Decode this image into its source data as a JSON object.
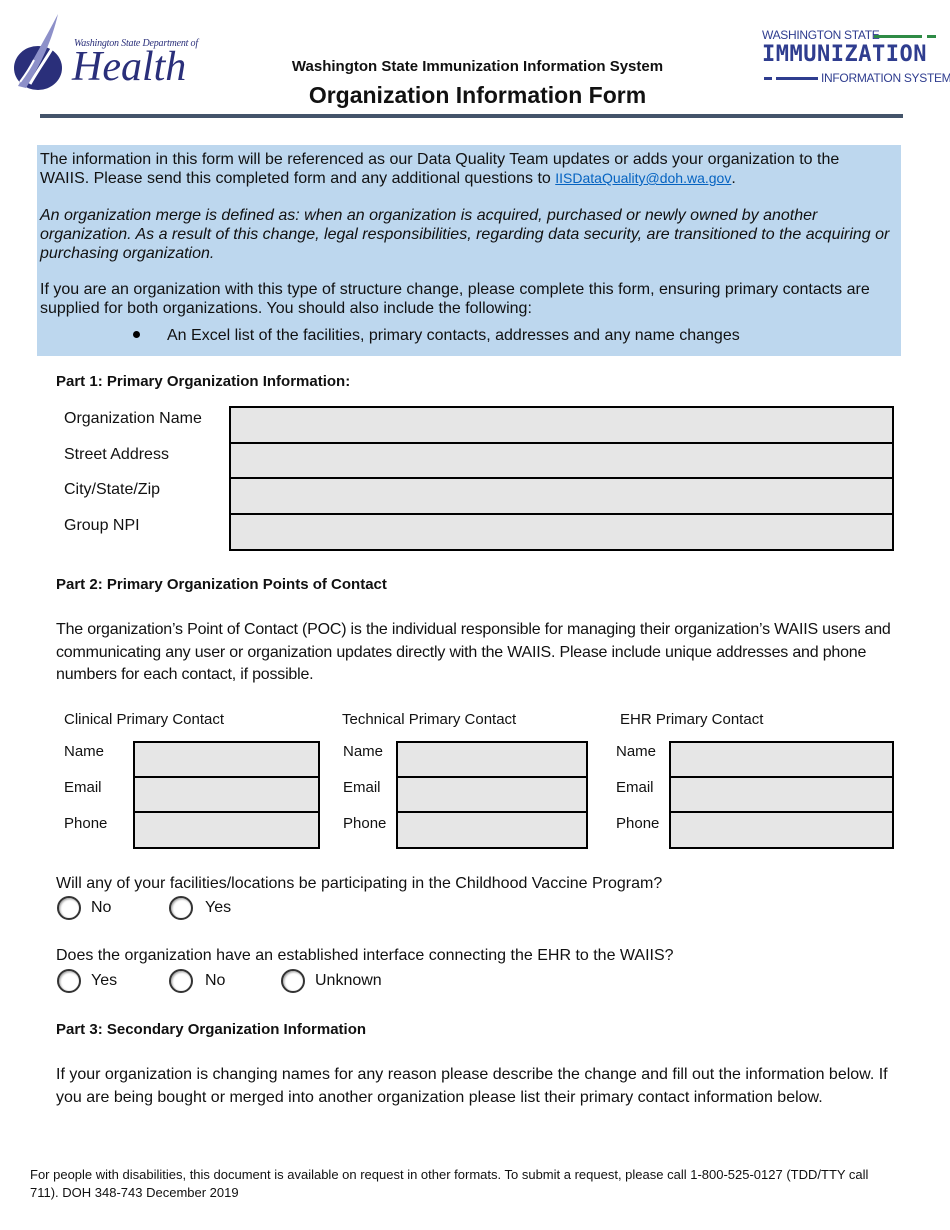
{
  "header": {
    "doh_logo": {
      "line1": "Washington State Department of",
      "line2": "Health"
    },
    "iis_logo": {
      "line1": "WASHINGTON STATE",
      "line2": "IMMUNIZATION",
      "line3": "INFORMATION SYSTEM"
    },
    "subtitle": "Washington State Immunization Information System",
    "title": "Organization Information Form"
  },
  "info_box": {
    "para1_text": "The information in this form will be referenced as our Data Quality Team updates or adds your organization to the WAIIS. Please send this completed form and any additional questions to ",
    "para1_email": "IISDataQuality@doh.wa.gov",
    "para1_end": ".",
    "para2": "An organization merge is defined as: when an organization is acquired, purchased or newly owned by another organization. As a result of this change, legal responsibilities, regarding data security, are transitioned to the acquiring or purchasing organization.",
    "para3": "If you are an organization with this type of structure change, please complete this form, ensuring primary contacts are supplied for both organizations. You should also include the following:",
    "bullets": [
      "An Excel list of the facilities, primary contacts, addresses and any name changes"
    ]
  },
  "part1": {
    "heading": "Part 1: Primary Organization Information:",
    "fields": [
      {
        "label": "Organization Name",
        "value": ""
      },
      {
        "label": "Street Address",
        "value": ""
      },
      {
        "label": "City/State/Zip",
        "value": ""
      },
      {
        "label": "Group NPI",
        "value": ""
      }
    ]
  },
  "part2": {
    "heading": "Part 2: Primary Organization Points of Contact",
    "description": "The organization’s Point of Contact (POC) is the individual responsible for managing their organization’s WAIIS users and communicating any user or organization updates directly with the WAIIS. Please include unique addresses and phone numbers for each contact, if possible.",
    "contacts": [
      {
        "title": "Clinical Primary Contact",
        "fields": [
          {
            "label": "Name",
            "value": ""
          },
          {
            "label": "Email",
            "value": ""
          },
          {
            "label": "Phone",
            "value": ""
          }
        ]
      },
      {
        "title": "Technical Primary Contact",
        "fields": [
          {
            "label": "Name",
            "value": ""
          },
          {
            "label": "Email",
            "value": ""
          },
          {
            "label": "Phone",
            "value": ""
          }
        ]
      },
      {
        "title": "EHR Primary Contact",
        "fields": [
          {
            "label": "Name",
            "value": ""
          },
          {
            "label": "Email",
            "value": ""
          },
          {
            "label": "Phone",
            "value": ""
          }
        ]
      }
    ],
    "question1": {
      "text": "Will any of your facilities/locations be participating in the Childhood Vaccine Program?",
      "options": [
        "No",
        "Yes"
      ],
      "selected": null
    },
    "question2": {
      "text": "Does the organization have an established interface connecting the EHR to the WAIIS?",
      "options": [
        "Yes",
        "No",
        "Unknown"
      ],
      "selected": null
    }
  },
  "part3": {
    "heading": "Part 3: Secondary Organization Information",
    "description": "If your organization is changing names for any reason please describe the change and fill out the information below. If you are being bought or merged into another organization please list their primary contact information below."
  },
  "footer": {
    "text": "For people with disabilities, this document is available on request in other formats. To submit a request, please call 1-800-525-0127 (TDD/TTY call 711). DOH 348-743 December 2019"
  },
  "colors": {
    "info_box_bg": "#bdd7ee",
    "header_rule": "#44546a",
    "link": "#0563c1",
    "field_bg": "#e6e6e6",
    "doh_blue": "#2a2f7a",
    "iis_green": "#2e8b45"
  }
}
